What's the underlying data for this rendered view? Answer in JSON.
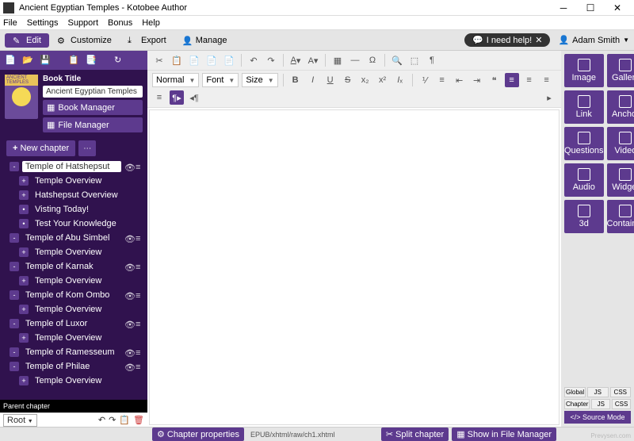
{
  "window": {
    "title": "Ancient Egyptian Temples - Kotobee Author"
  },
  "menubar": [
    "File",
    "Settings",
    "Support",
    "Bonus",
    "Help"
  ],
  "toolbar": {
    "edit": "Edit",
    "customize": "Customize",
    "export": "Export",
    "manage": "Manage",
    "help": "I need help!",
    "user": "Adam Smith"
  },
  "book": {
    "titleLabel": "Book Title",
    "title": "Ancient Egyptian Temples",
    "coverTag": "ANCIENT TEMPLES",
    "bookManager": "Book Manager",
    "fileManager": "File Manager"
  },
  "newChapter": "New chapter",
  "tree": [
    {
      "lvl": 1,
      "exp": "-",
      "label": "Temple of Hatshepsut",
      "sel": true,
      "acts": true
    },
    {
      "lvl": 2,
      "exp": "+",
      "label": "Temple Overview"
    },
    {
      "lvl": 2,
      "exp": "+",
      "label": "Hatshepsut Overview"
    },
    {
      "lvl": 2,
      "exp": "",
      "label": "Visting Today!"
    },
    {
      "lvl": 2,
      "exp": "",
      "label": "Test Your Knowledge"
    },
    {
      "lvl": 1,
      "exp": "-",
      "label": "Temple of Abu Simbel",
      "acts": true
    },
    {
      "lvl": 2,
      "exp": "+",
      "label": "Temple Overview"
    },
    {
      "lvl": 1,
      "exp": "-",
      "label": "Temple of Karnak",
      "acts": true
    },
    {
      "lvl": 2,
      "exp": "+",
      "label": "Temple Overview"
    },
    {
      "lvl": 1,
      "exp": "-",
      "label": "Temple of Kom Ombo",
      "acts": true
    },
    {
      "lvl": 2,
      "exp": "+",
      "label": "Temple Overview"
    },
    {
      "lvl": 1,
      "exp": "-",
      "label": "Temple of Luxor",
      "acts": true
    },
    {
      "lvl": 2,
      "exp": "+",
      "label": "Temple Overview"
    },
    {
      "lvl": 1,
      "exp": "-",
      "label": "Temple of Ramesseum",
      "acts": true
    },
    {
      "lvl": 1,
      "exp": "-",
      "label": "Temple of Philae",
      "acts": true
    },
    {
      "lvl": 2,
      "exp": "+",
      "label": "Temple Overview"
    }
  ],
  "parentChapter": "Parent chapter",
  "rootSel": "Root",
  "editor": {
    "style": "Normal",
    "font": "Font",
    "size": "Size"
  },
  "insert": [
    {
      "n": "image",
      "l": "Image"
    },
    {
      "n": "gallery",
      "l": "Gallery"
    },
    {
      "n": "link",
      "l": "Link"
    },
    {
      "n": "anchor",
      "l": "Anchor"
    },
    {
      "n": "questions",
      "l": "Questions"
    },
    {
      "n": "video",
      "l": "Video"
    },
    {
      "n": "audio",
      "l": "Audio"
    },
    {
      "n": "widget",
      "l": "Widget"
    },
    {
      "n": "3d",
      "l": "3d"
    },
    {
      "n": "container",
      "l": "Container"
    }
  ],
  "codeTabs": {
    "global": "Global",
    "chapter": "Chapter",
    "js": "JS",
    "css": "CSS",
    "source": "</> Source Mode"
  },
  "bottom": {
    "chapProps": "Chapter properties",
    "path": "EPUB/xhtml/raw/ch1.xhtml",
    "split": "Split chapter",
    "showFM": "Show in File Manager"
  },
  "watermark": "Prevysen.com"
}
